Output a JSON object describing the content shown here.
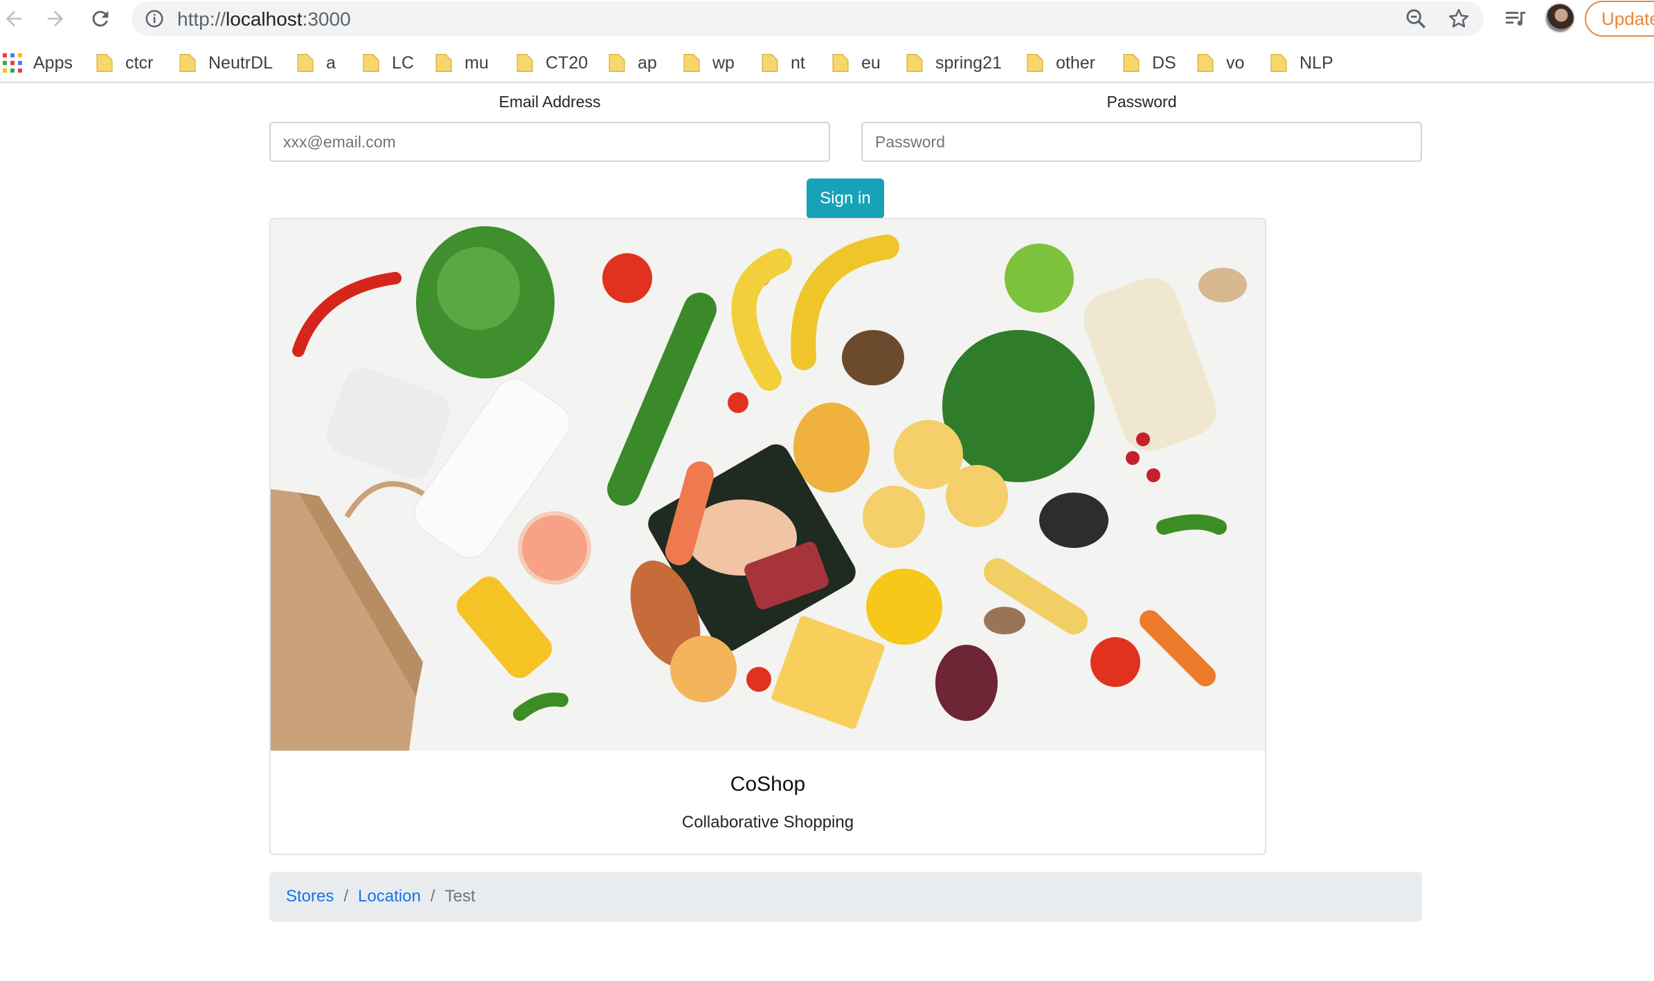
{
  "browser": {
    "url_scheme": "http://",
    "url_host": "localhost",
    "url_port": ":3000",
    "update_label": "Update",
    "bookmarks": [
      {
        "label": "Apps"
      },
      {
        "label": "ctcr"
      },
      {
        "label": "NeutrDL"
      },
      {
        "label": "a"
      },
      {
        "label": "LC"
      },
      {
        "label": "mu"
      },
      {
        "label": "CT20"
      },
      {
        "label": "ap"
      },
      {
        "label": "wp"
      },
      {
        "label": "nt"
      },
      {
        "label": "eu"
      },
      {
        "label": "spring21"
      },
      {
        "label": "other"
      },
      {
        "label": "DS"
      },
      {
        "label": "vo"
      },
      {
        "label": "NLP"
      }
    ]
  },
  "login": {
    "email_label": "Email Address",
    "email_placeholder": "xxx@email.com",
    "password_label": "Password",
    "password_placeholder": "Password",
    "signin_label": "Sign in"
  },
  "card": {
    "title": "CoShop",
    "subtitle": "Collaborative Shopping"
  },
  "breadcrumb": {
    "items": [
      {
        "label": "Stores"
      },
      {
        "label": "Location"
      },
      {
        "label": "Test"
      }
    ]
  },
  "colors": {
    "primary_button": "#17a2b8",
    "link": "#1a73e8",
    "breadcrumb_bg": "#e9ecef",
    "update_accent": "#e8873c"
  }
}
